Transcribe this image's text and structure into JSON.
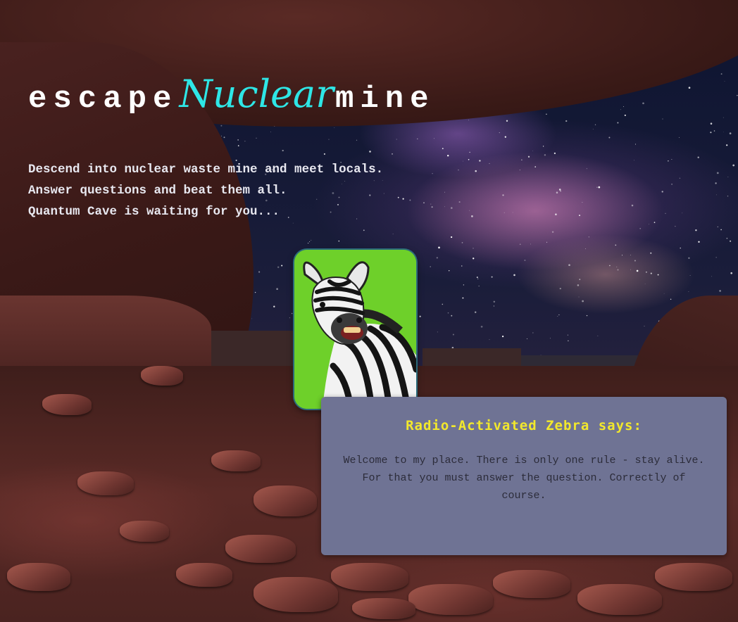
{
  "title": {
    "part1": "escape",
    "part2": "Nuclear",
    "part3": "mine"
  },
  "tagline": [
    "Descend into nuclear waste mine and meet locals.",
    "Answer questions and beat them all.",
    "Quantum Cave is waiting for you..."
  ],
  "character": {
    "avatar_icon": "zebra-portrait",
    "speaker": "Radio-Activated Zebra says:",
    "message": "Welcome to my place. There is only one rule - stay alive. For that you must answer the question. Correctly of course."
  },
  "colors": {
    "accent": "#2ee6e6",
    "speaker": "#f2e82c",
    "dialog_bg": "#6f7394",
    "avatar_bg": "#6ed02a"
  }
}
